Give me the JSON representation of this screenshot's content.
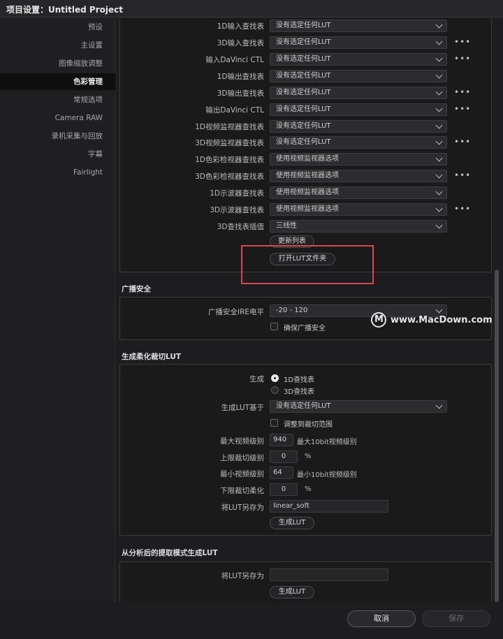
{
  "window": {
    "title": "项目设置：Untitled Project"
  },
  "sidebar": {
    "items": [
      {
        "label": "预设"
      },
      {
        "label": "主设置"
      },
      {
        "label": "图像缩放调整"
      },
      {
        "label": "色彩管理"
      },
      {
        "label": "常规选项"
      },
      {
        "label": "Camera RAW"
      },
      {
        "label": "录机采集与回放"
      },
      {
        "label": "字幕"
      },
      {
        "label": "Fairlight"
      }
    ],
    "active_index": 3
  },
  "lut": {
    "rows": [
      {
        "label": "1D输入查找表",
        "value": "没有选定任何LUT"
      },
      {
        "label": "3D输入查找表",
        "value": "没有选定任何LUT"
      },
      {
        "label": "输入DaVinci CTL",
        "value": "没有选定任何LUT"
      },
      {
        "label": "1D输出查找表",
        "value": "没有选定任何LUT"
      },
      {
        "label": "3D输出查找表",
        "value": "没有选定任何LUT"
      },
      {
        "label": "输出DaVinci CTL",
        "value": "没有选定任何LUT"
      },
      {
        "label": "1D视频监视器查找表",
        "value": "没有选定任何LUT"
      },
      {
        "label": "3D视频监视器查找表",
        "value": "没有选定任何LUT"
      },
      {
        "label": "1D色彩检视器查找表",
        "value": "使用视频监视器选项"
      },
      {
        "label": "3D色彩检视器查找表",
        "value": "使用视频监视器选项"
      },
      {
        "label": "1D示波器查找表",
        "value": "使用视频监视器选项"
      },
      {
        "label": "3D示波器查找表",
        "value": "使用视频监视器选项"
      },
      {
        "label": "3D查找表插值",
        "value": "三线性"
      }
    ],
    "more_icon": "ellipsis-icon",
    "update_button": "更新列表",
    "open_folder_button": "打开LUT文件夹"
  },
  "broadcast": {
    "title": "广播安全",
    "ire_label": "广播安全IRE电平",
    "ire_value": "-20 - 120",
    "ensure_label": "确保广播安全"
  },
  "soft_clip": {
    "title": "生成柔化裁切LUT",
    "generate_label": "生成",
    "option_1d": "1D查找表",
    "option_3d": "3D查找表",
    "based_on_label": "生成LUT基于",
    "based_on_value": "没有选定任何LUT",
    "adjust_label": "调整到裁切范围",
    "max_video_label": "最大视频级别",
    "max_video_value": "940",
    "max_video_hint": "最大10bit视频级别",
    "upper_clip_label": "上限裁切级别",
    "upper_clip_value": "0",
    "min_video_label": "最小视频级别",
    "min_video_value": "64",
    "min_video_hint": "最小10bit视频级别",
    "lower_soft_label": "下限裁切柔化",
    "lower_soft_value": "0",
    "percent": "%",
    "save_as_label": "将LUT另存为",
    "save_as_value": "linear_soft",
    "generate_button": "生成LUT"
  },
  "extract": {
    "title": "从分析后的提取模式生成LUT",
    "save_as_label": "将LUT另存为",
    "save_as_value": "",
    "generate_button": "生成LUT"
  },
  "watermark": {
    "logo_letter": "M",
    "text": "www.MacDown.com"
  },
  "footer": {
    "cancel": "取消",
    "save": "保存"
  },
  "colors": {
    "highlight": "#d9474d",
    "background": "#1d1d1f"
  }
}
